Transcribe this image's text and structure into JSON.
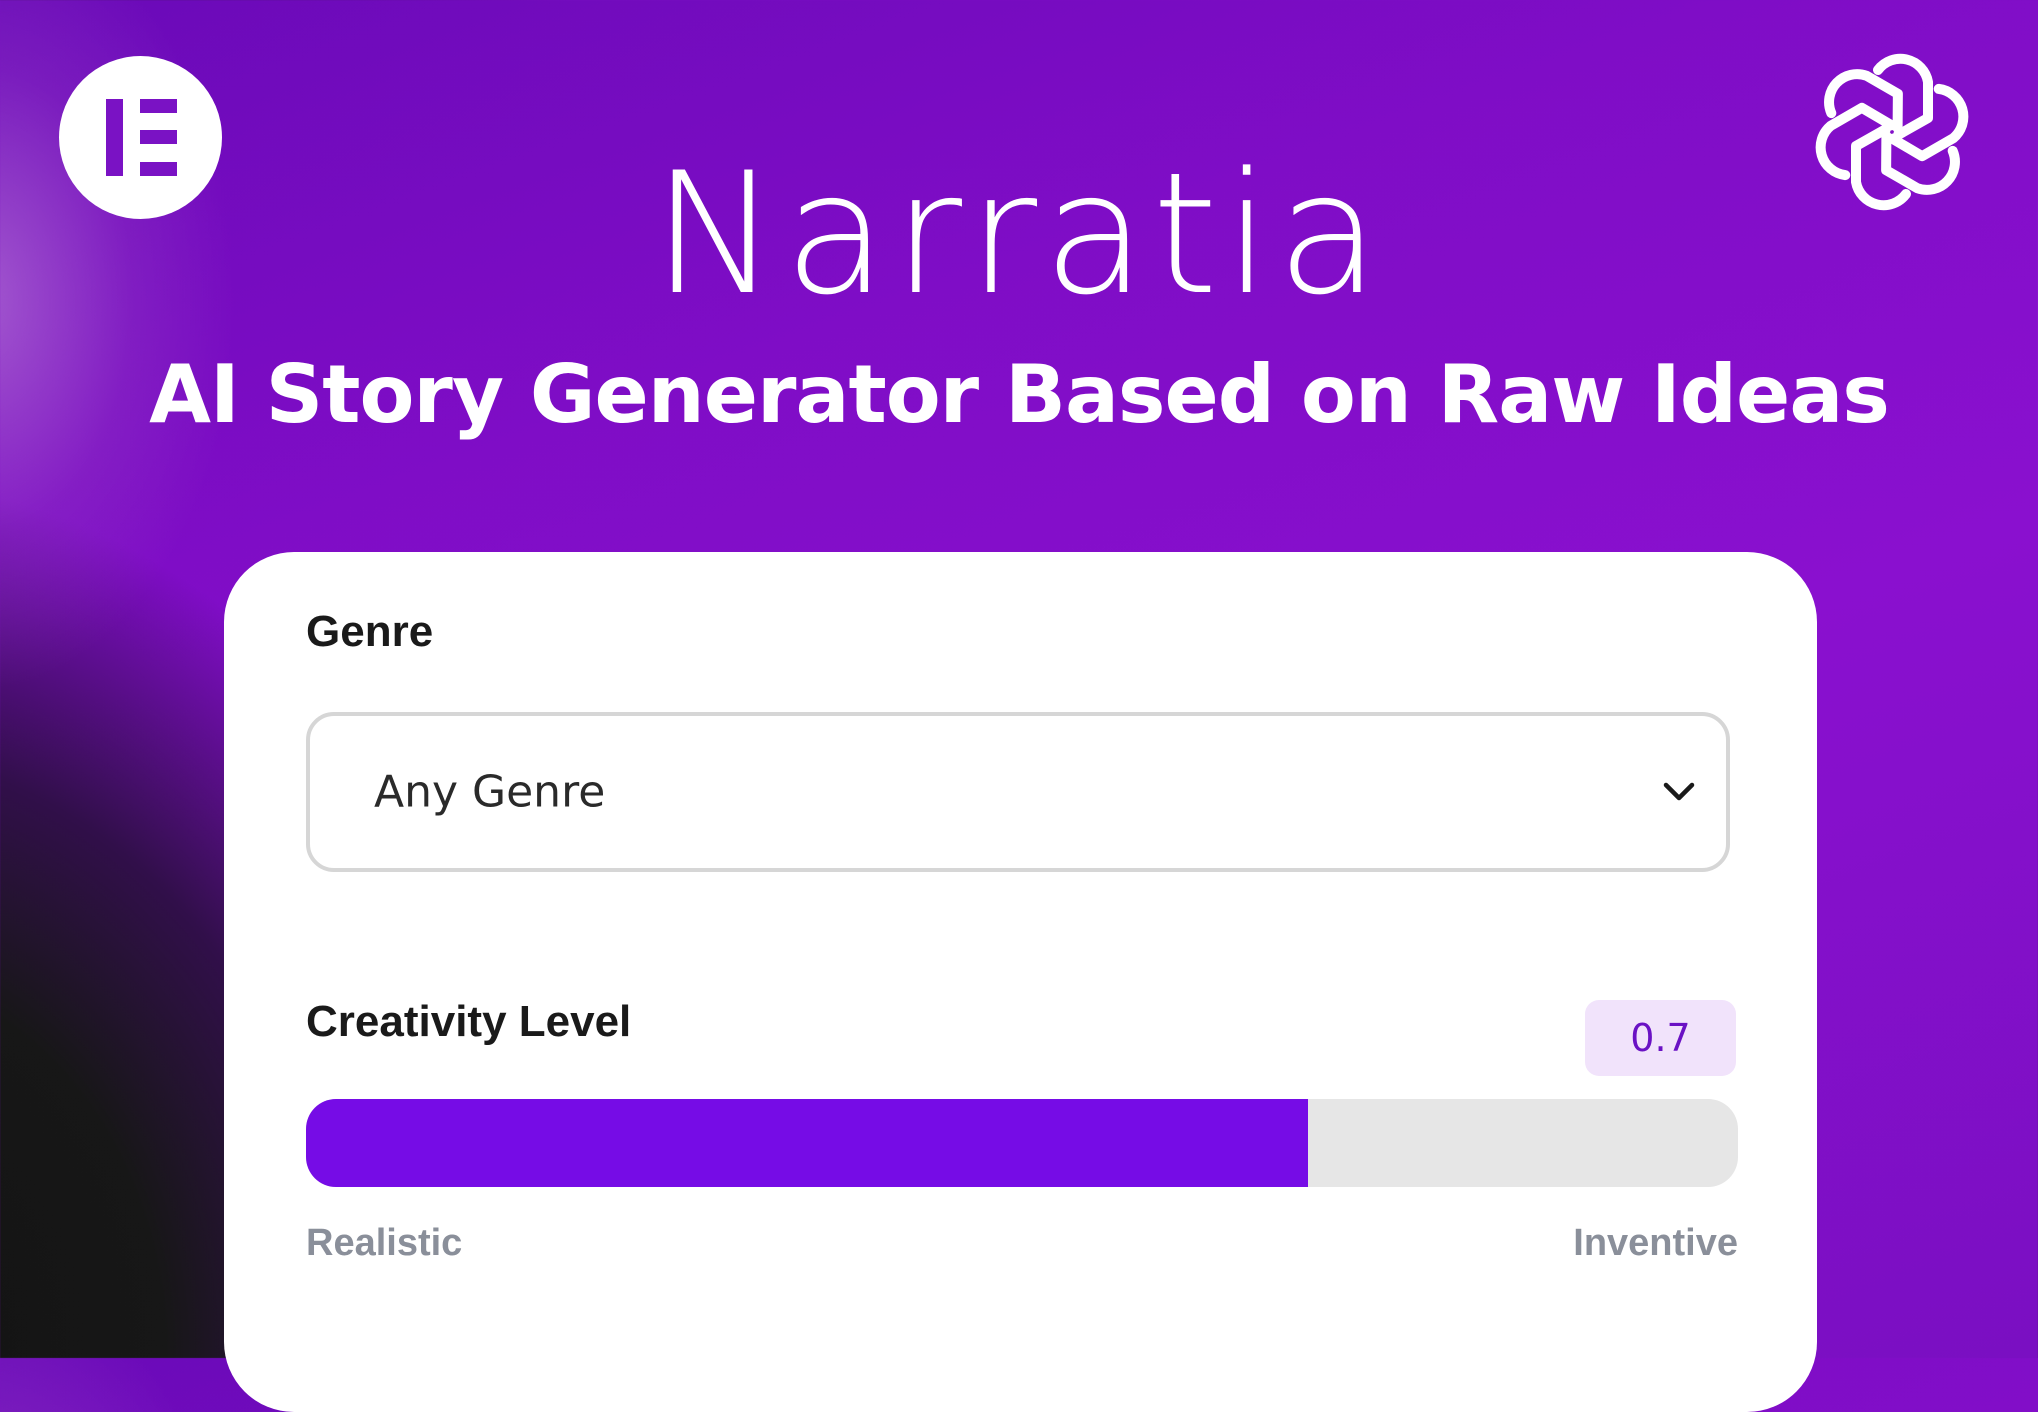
{
  "header": {
    "title": "Narratia",
    "subtitle": "AI Story Generator Based on Raw Ideas"
  },
  "icons": {
    "left_logo": "elementor-logo-icon",
    "right_logo": "openai-logo-icon"
  },
  "form": {
    "genre": {
      "label": "Genre",
      "selected": "Any Genre"
    },
    "creativity": {
      "label": "Creativity Level",
      "value": "0.7",
      "fraction": 0.7,
      "min_label": "Realistic",
      "max_label": "Inventive"
    }
  },
  "colors": {
    "accent": "#760ce6",
    "badge_bg": "#f1e3fb",
    "track": "#e6e6e6"
  }
}
